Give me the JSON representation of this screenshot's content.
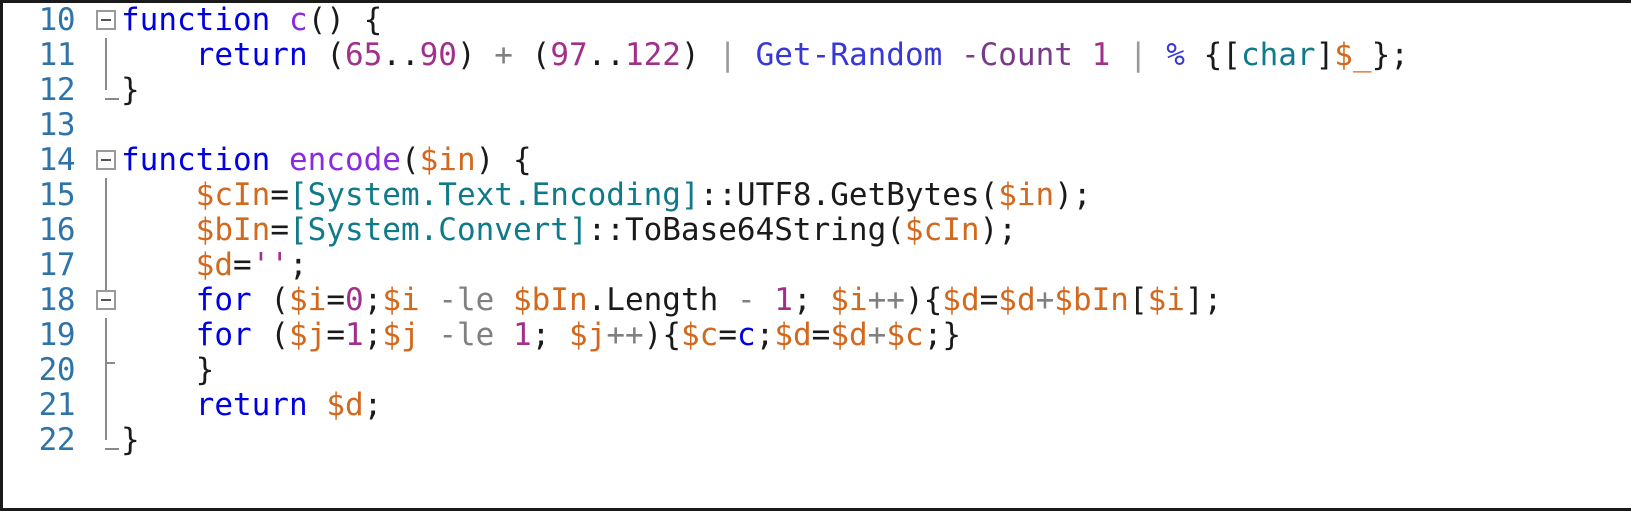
{
  "editor": {
    "language": "PowerShell",
    "first_line_number": 10,
    "last_line_number": 22,
    "gutter_numbers": [
      "10",
      "11",
      "12",
      "13",
      "14",
      "15",
      "16",
      "17",
      "18",
      "19",
      "20",
      "21",
      "22"
    ],
    "colors": {
      "background": "#ffffff",
      "line_number": "#2e74a8",
      "keyword": "#0000e0",
      "function_name": "#8a2be2",
      "variable": "#d2691e",
      "number": "#a0308a",
      "type": "#0f7a8a",
      "cmdlet": "#3838d8",
      "parameter": "#7a3a8a",
      "operator": "#808080",
      "punctuation": "#1a1a1a",
      "string": "#a0308a",
      "fold_marker": "#9a9a9a"
    },
    "fold_markers": [
      {
        "line": "10",
        "state": "expanded",
        "glyph": "minus-box"
      },
      {
        "line": "14",
        "state": "expanded",
        "glyph": "minus-box"
      },
      {
        "line": "18",
        "state": "expanded",
        "glyph": "minus-box"
      }
    ],
    "lines": [
      {
        "num": "10",
        "text": "function c() {"
      },
      {
        "num": "11",
        "text": "    return (65..90) + (97..122) | Get-Random -Count 1 | % {[char]$_};"
      },
      {
        "num": "12",
        "text": "}"
      },
      {
        "num": "13",
        "text": ""
      },
      {
        "num": "14",
        "text": "function encode($in) {"
      },
      {
        "num": "15",
        "text": "    $cIn=[System.Text.Encoding]::UTF8.GetBytes($in);"
      },
      {
        "num": "16",
        "text": "    $bIn=[System.Convert]::ToBase64String($cIn);"
      },
      {
        "num": "17",
        "text": "    $d='';"
      },
      {
        "num": "18",
        "text": "    for ($i=0;$i -le $bIn.Length - 1; $i++){$d=$d+$bIn[$i];"
      },
      {
        "num": "19",
        "text": "    for ($j=1;$j -le 1; $j++){$c=c;$d=$d+$c;}"
      },
      {
        "num": "20",
        "text": "    }"
      },
      {
        "num": "21",
        "text": "    return $d;"
      },
      {
        "num": "22",
        "text": "}"
      }
    ],
    "tokens": {
      "l10": {
        "kw_function": "function",
        "fn_name": " c",
        "parens": "() {"
      },
      "l11": {
        "indent": "    ",
        "kw_return": "return",
        "sp": " ",
        "open1": "(",
        "n65": "65",
        "range": "..",
        "n90": "90",
        "close1": ")",
        "plus": " + ",
        "open2": "(",
        "n97": "97",
        "n122": "122",
        "close2": ")",
        "pipe1": " | ",
        "cmdlet": "Get-Random",
        "param": " -Count",
        "n1": " 1",
        "pipe2": " | ",
        "pct": "%",
        "brace_open": " {",
        "bracket_open": "[",
        "type_char": "char",
        "bracket_close": "]",
        "var_underscore": "$_",
        "brace_close": "}",
        "semi": ";"
      },
      "l12": {
        "brace": "}"
      },
      "l14": {
        "kw_function": "function",
        "fn_name": " encode",
        "paren_open": "(",
        "param_var": "$in",
        "paren_close": ")",
        "brace": " {"
      },
      "l15": {
        "indent": "    ",
        "var": "$cIn",
        "eq": "=",
        "type": "[System.Text.Encoding]",
        "scope": "::",
        "member": "UTF8.GetBytes",
        "paren_open": "(",
        "arg": "$in",
        "tail": ");"
      },
      "l16": {
        "indent": "    ",
        "var": "$bIn",
        "eq": "=",
        "type": "[System.Convert]",
        "scope": "::",
        "member": "ToBase64String",
        "paren_open": "(",
        "arg": "$cIn",
        "tail": ");"
      },
      "l17": {
        "indent": "    ",
        "var": "$d",
        "eq": "=",
        "str": "''",
        "semi": ";"
      },
      "l18": {
        "indent": "    ",
        "kw_for": "for",
        "paren_open": " (",
        "var_i": "$i",
        "eq": "=",
        "zero": "0",
        "semi1": ";",
        "var_i2": "$i",
        "op_le": " -le ",
        "var_bin": "$bIn",
        "member": ".Length",
        "minus": " - ",
        "one": "1",
        "semi2": "; ",
        "var_i3": "$i",
        "incr": "++",
        "paren_close": ")",
        "brace_open": "{",
        "var_d": "$d",
        "eq2": "=",
        "var_d2": "$d",
        "plus": "+",
        "var_bin2": "$bIn",
        "idx_open": "[",
        "var_i4": "$i",
        "idx_close": "]",
        "semi3": ";"
      },
      "l19": {
        "indent": "    ",
        "kw_for": "for",
        "paren_open": " (",
        "var_j": "$j",
        "eq": "=",
        "one": "1",
        "semi1": ";",
        "var_j2": "$j",
        "op_le": " -le ",
        "one2": "1",
        "semi2": "; ",
        "var_j3": "$j",
        "incr": "++",
        "paren_close": ")",
        "brace_open": "{",
        "var_c": "$c",
        "eq2": "=",
        "call_c": "c",
        "semi3": ";",
        "var_d": "$d",
        "eq3": "=",
        "var_d2": "$d",
        "plus": "+",
        "var_c2": "$c",
        "semi4": ";",
        "brace_close": "}"
      },
      "l20": {
        "indent": "    ",
        "brace": "}"
      },
      "l21": {
        "indent": "    ",
        "kw_return": "return",
        "sp": " ",
        "var_d": "$d",
        "semi": ";"
      },
      "l22": {
        "brace": "}"
      }
    }
  }
}
